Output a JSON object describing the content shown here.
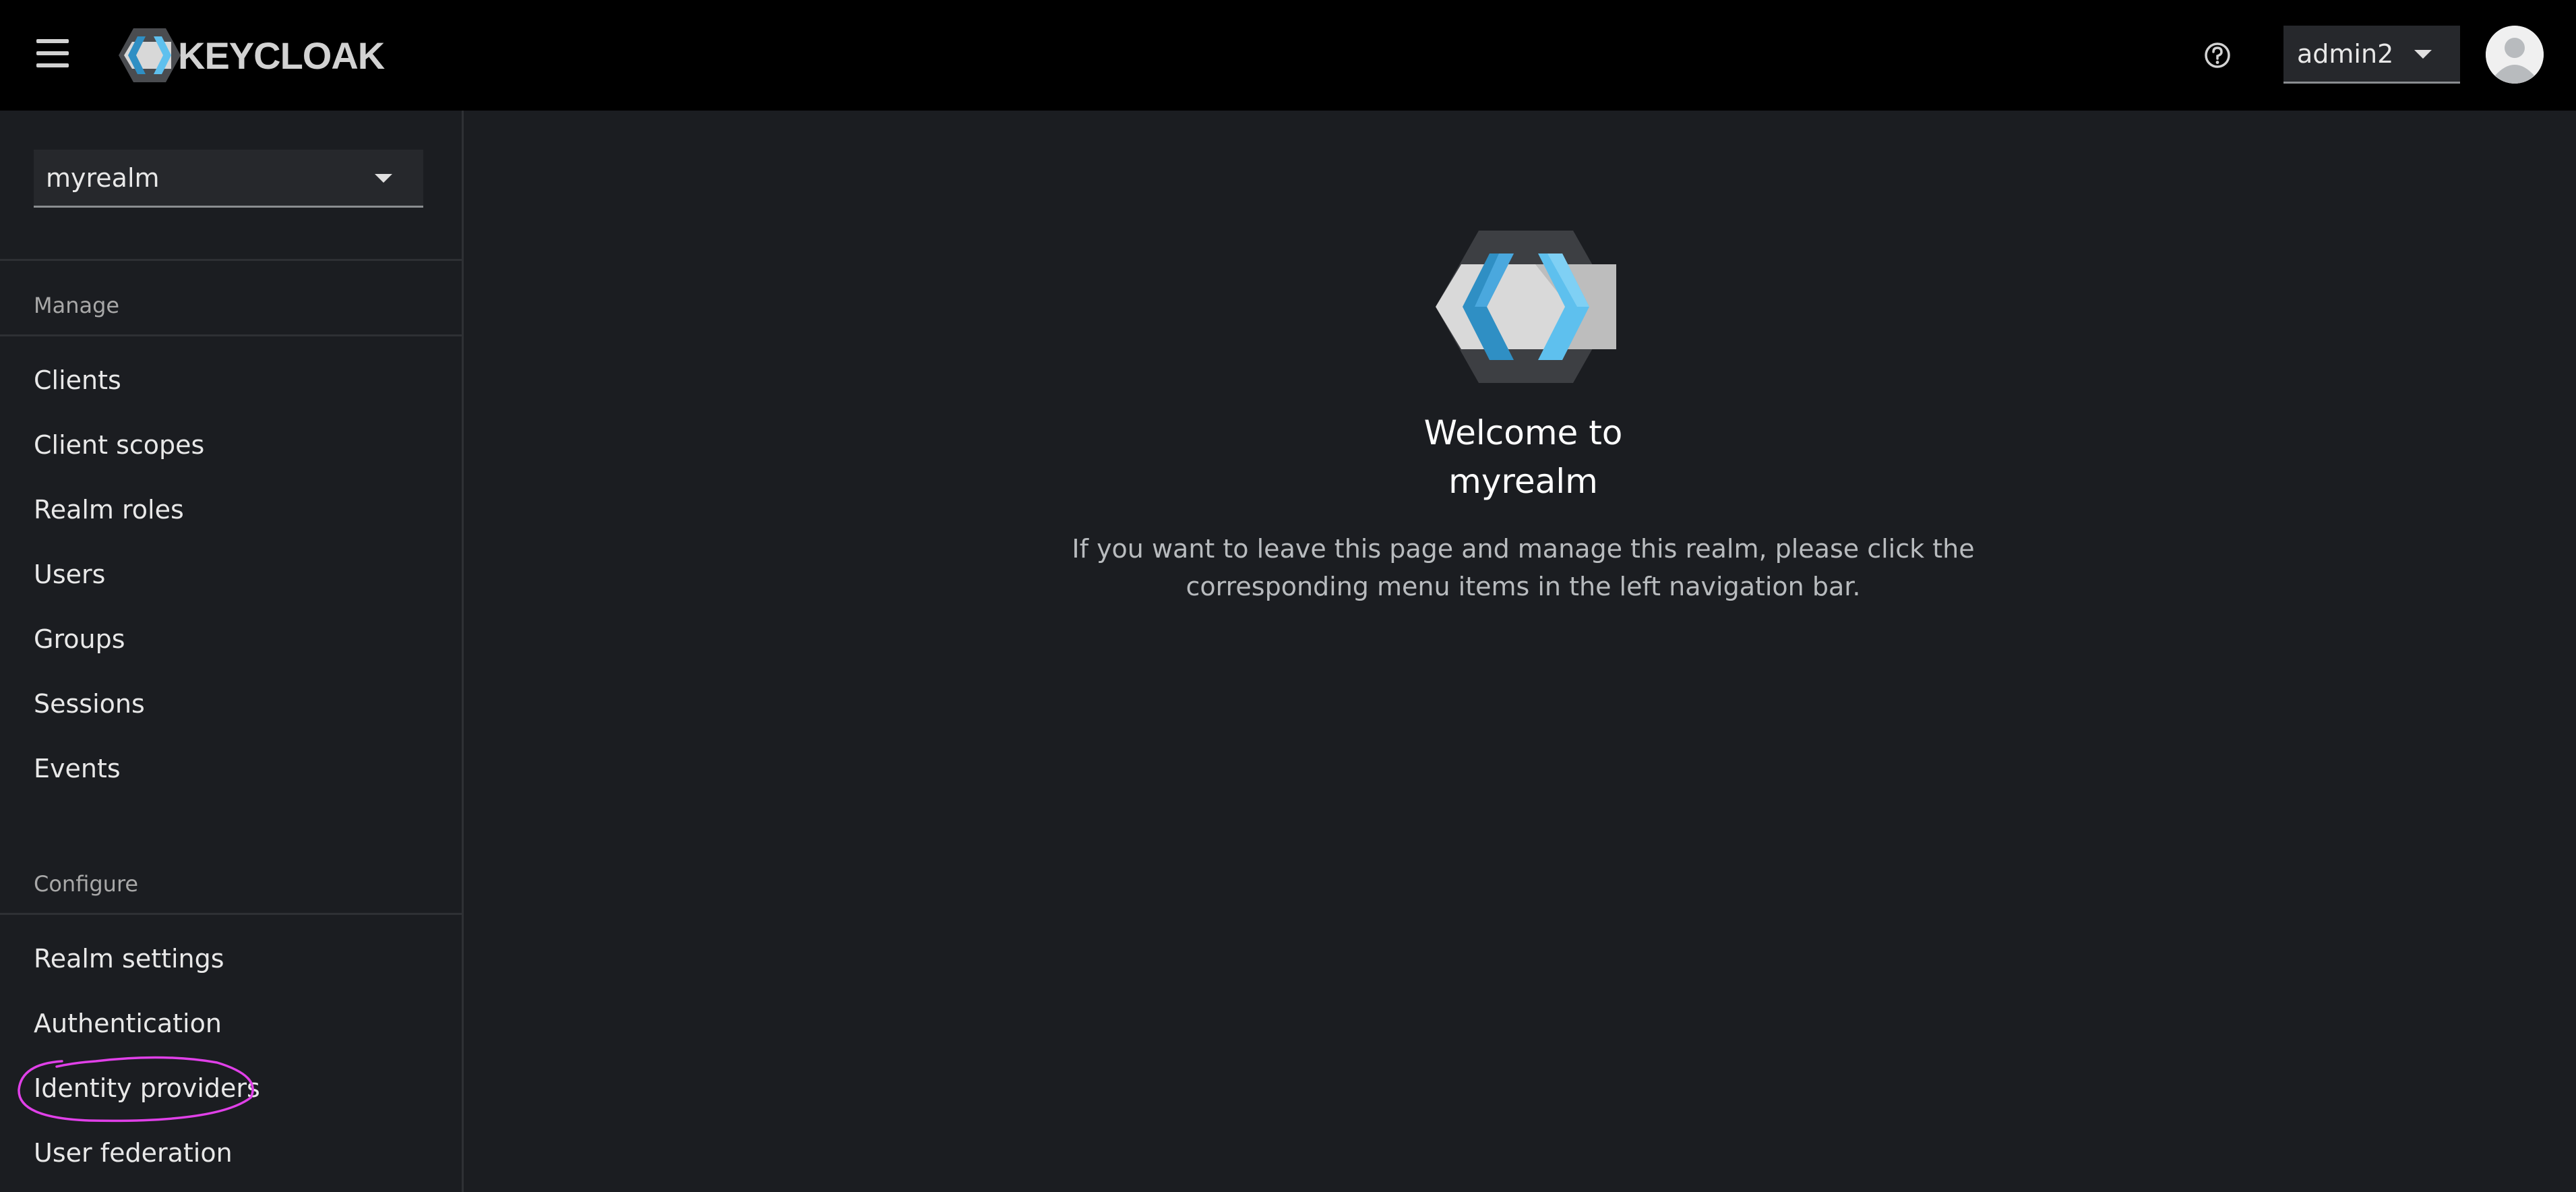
{
  "header": {
    "brand_text": "KEYCLOAK",
    "user_name": "admin2",
    "icons": {
      "menu": "hamburger-menu-icon",
      "help": "help-circle-icon",
      "avatar": "user-avatar-icon"
    }
  },
  "sidebar": {
    "realm_selected": "myrealm",
    "manage_title": "Manage",
    "manage_items": [
      {
        "label": "Clients"
      },
      {
        "label": "Client scopes"
      },
      {
        "label": "Realm roles"
      },
      {
        "label": "Users"
      },
      {
        "label": "Groups"
      },
      {
        "label": "Sessions"
      },
      {
        "label": "Events"
      }
    ],
    "configure_title": "Configure",
    "configure_items": [
      {
        "label": "Realm settings"
      },
      {
        "label": "Authentication"
      },
      {
        "label": "Identity providers"
      },
      {
        "label": "User federation"
      }
    ],
    "highlight_color": "#e040e8"
  },
  "main": {
    "welcome_line1": "Welcome to",
    "welcome_line2": "myrealm",
    "description": "If you want to leave this page and manage this realm, please click the corresponding menu items in the left navigation bar."
  },
  "colors": {
    "masthead_bg": "#000000",
    "page_bg": "#1b1d21",
    "logo_blue": "#4db6e8"
  }
}
